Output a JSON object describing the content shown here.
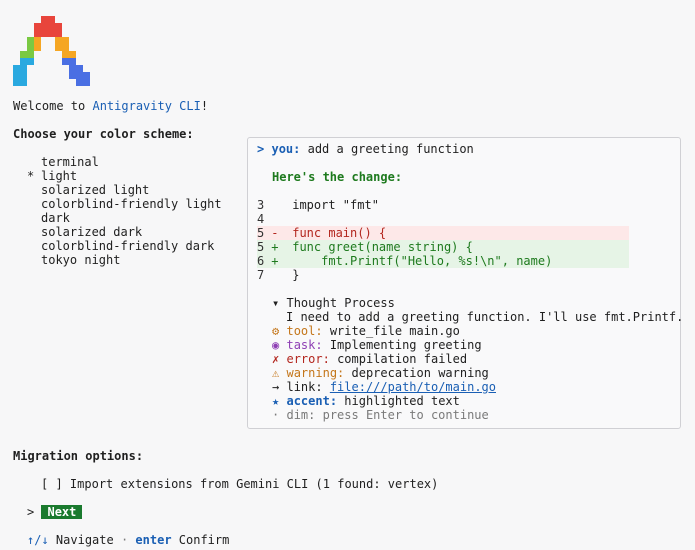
{
  "welcome": {
    "prefix": "Welcome to ",
    "app_name": "Antigravity CLI",
    "suffix": "!"
  },
  "scheme": {
    "heading": "Choose your color scheme:",
    "selected_marker": "*",
    "options": [
      "terminal",
      "light",
      "solarized light",
      "colorblind-friendly light",
      "dark",
      "solarized dark",
      "colorblind-friendly dark",
      "tokyo night"
    ],
    "selected_index": 1
  },
  "preview": {
    "prompt_symbol": ">",
    "you_label": "you:",
    "user_message": "add a greeting function",
    "response_heading": "Here's the change:",
    "code": [
      {
        "num": "3",
        "mark": " ",
        "text": "import \"fmt\"",
        "kind": "ctx"
      },
      {
        "num": "4",
        "mark": " ",
        "text": "",
        "kind": "ctx"
      },
      {
        "num": "5",
        "mark": "-",
        "text": "func main() {",
        "kind": "del"
      },
      {
        "num": "5",
        "mark": "+",
        "text": "func greet(name string) {",
        "kind": "add"
      },
      {
        "num": "6",
        "mark": "+",
        "text": "    fmt.Printf(\"Hello, %s!\\n\", name)",
        "kind": "add"
      },
      {
        "num": "7",
        "mark": " ",
        "text": "}",
        "kind": "ctx"
      }
    ],
    "thought_toggle": "▾",
    "thought_title": "Thought Process",
    "thought_text": "I need to add a greeting function. I'll use fmt.Printf.",
    "tool": {
      "icon": "⚙",
      "label": "tool:",
      "text": "write_file main.go"
    },
    "task": {
      "icon": "◉",
      "label": "task:",
      "text": "Implementing greeting"
    },
    "error": {
      "icon": "✗",
      "label": "error:",
      "text": "compilation failed"
    },
    "warning": {
      "icon": "⚠",
      "label": "warning:",
      "text": "deprecation warning"
    },
    "link": {
      "icon": "→",
      "label": "link:",
      "text": "file:///path/to/main.go"
    },
    "accent": {
      "icon": "★",
      "label": "accent:",
      "text": "highlighted text"
    },
    "dim": {
      "icon": "·",
      "text": "dim: press Enter to continue"
    }
  },
  "migration": {
    "heading": "Migration options:",
    "checkbox": "[ ]",
    "option_label": "Import extensions from Gemini CLI (1 found: vertex)"
  },
  "next": {
    "caret": ">",
    "label": "Next"
  },
  "footer": {
    "arrows": "↑/↓",
    "navigate": "Navigate",
    "sep": "·",
    "enter": "enter",
    "confirm": "Confirm"
  },
  "colors": {
    "accent_blue": "#1a5fb4",
    "success_green": "#1e7a1e",
    "button_green": "#1a7a2e",
    "error_red": "#b3261e",
    "warning_orange": "#c4761a",
    "task_purple": "#8e3fb4",
    "logo_gradient": [
      "#e8453c",
      "#f5a623",
      "#7ac943",
      "#2aa9e0",
      "#4a6fe3"
    ]
  }
}
